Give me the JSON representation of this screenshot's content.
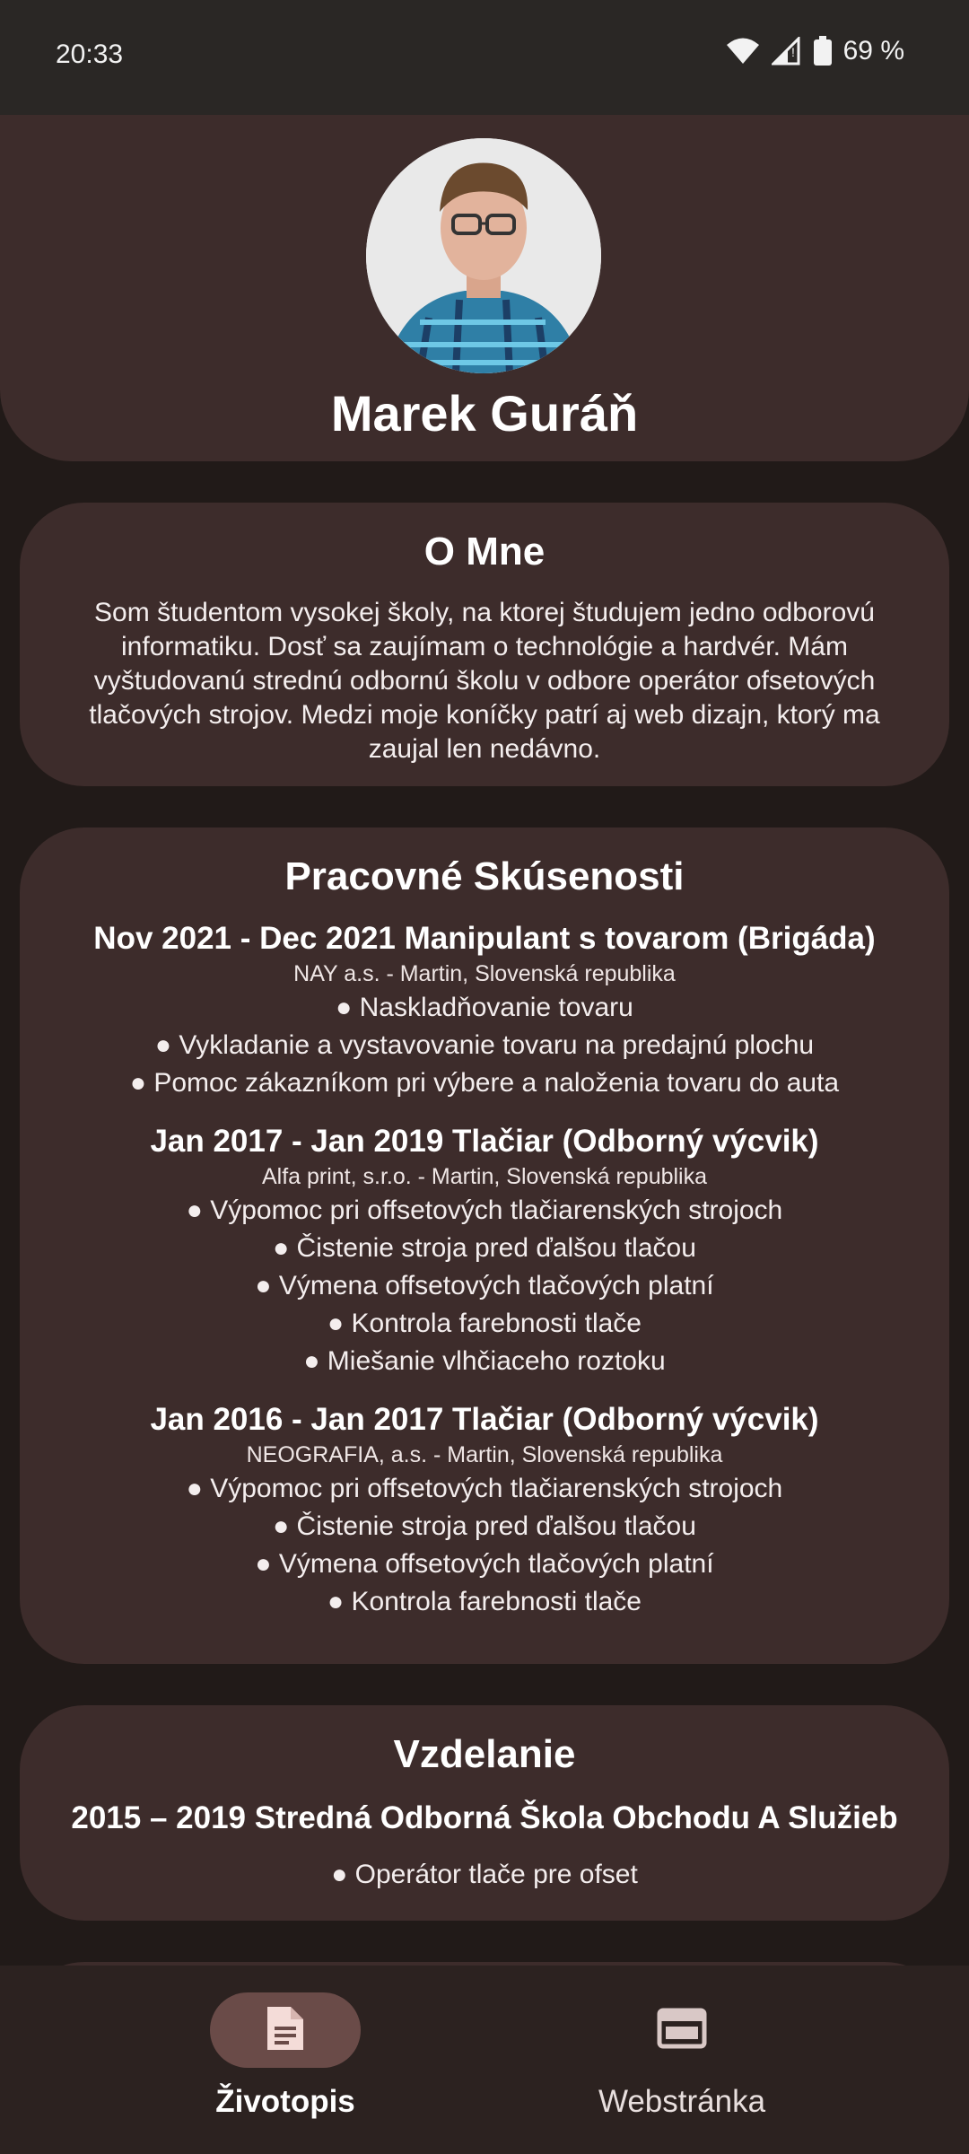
{
  "status_bar": {
    "time": "20:33",
    "battery": "69 %",
    "icons": [
      "wifi-icon",
      "signal-icon",
      "battery-icon"
    ]
  },
  "profile": {
    "name": "Marek Guráň",
    "avatar": "avatar-photo"
  },
  "about": {
    "title": "O Mne",
    "text": "Som študentom vysokej školy, na ktorej študujem jedno odborovú informatiku. Dosť sa zaujímam o technológie a hardvér. Mám vyštudovanú strednú odbornú školu v odbore operátor ofsetových tlačových strojov. Medzi moje koníčky patrí aj web dizajn, ktorý ma zaujal len nedávno."
  },
  "experience": {
    "title": "Pracovné Skúsenosti",
    "jobs": [
      {
        "title": "Nov 2021 - Dec 2021 Manipulant s tovarom (Brigáda)",
        "company": "NAY a.s. - Martin, Slovenská republika",
        "bullets": [
          "● Naskladňovanie tovaru",
          "● Vykladanie a vystavovanie tovaru na predajnú plochu",
          "● Pomoc zákazníkom pri výbere a naloženia tovaru do auta"
        ]
      },
      {
        "title": "Jan 2017 - Jan 2019 Tlačiar (Odborný výcvik)",
        "company": "Alfa print, s.r.o. - Martin, Slovenská republika",
        "bullets": [
          "● Výpomoc pri offsetových tlačiarenských strojoch",
          "● Čistenie stroja pred ďalšou tlačou",
          "● Výmena offsetových tlačových platní",
          "● Kontrola farebnosti tlače",
          "● Miešanie vlhčiaceho roztoku"
        ]
      },
      {
        "title": "Jan 2016 - Jan 2017 Tlačiar (Odborný výcvik)",
        "company": "NEOGRAFIA, a.s. - Martin, Slovenská republika",
        "bullets": [
          "● Výpomoc pri offsetových tlačiarenských strojoch",
          "● Čistenie stroja pred ďalšou tlačou",
          "● Výmena offsetových tlačových platní",
          "● Kontrola farebnosti tlače"
        ]
      }
    ]
  },
  "education": {
    "title": "Vzdelanie",
    "school": "2015 – 2019 Stredná Odborná Škola Obchodu A Služieb",
    "items": [
      "● Operátor tlače pre ofset"
    ]
  },
  "bottom_nav": {
    "items": [
      {
        "label": "Životopis",
        "icon": "document-icon",
        "active": true
      },
      {
        "label": "Webstránka",
        "icon": "web-icon",
        "active": false
      }
    ]
  },
  "colors": {
    "background": "#211a18",
    "card": "#3d2c2b",
    "nav_active_pill": "#6a4b48"
  }
}
